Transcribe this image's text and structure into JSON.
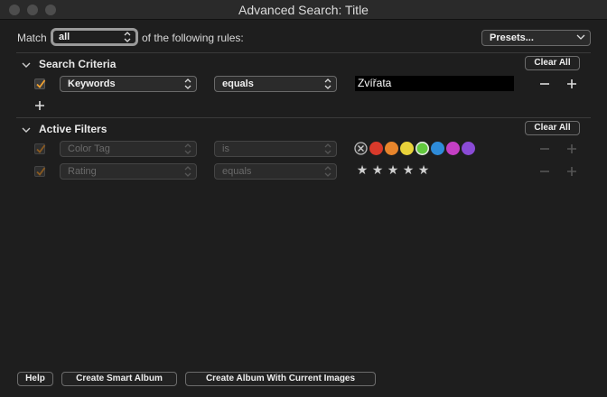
{
  "window": {
    "title": "Advanced Search: Title"
  },
  "match": {
    "prefix": "Match",
    "selected": "all",
    "suffix": "of the following rules:"
  },
  "presets": {
    "label": "Presets..."
  },
  "search_criteria": {
    "title": "Search Criteria",
    "clear_label": "Clear All",
    "rules": [
      {
        "field": "Keywords",
        "operator": "equals",
        "value": "Zvířata"
      }
    ]
  },
  "active_filters": {
    "title": "Active Filters",
    "clear_label": "Clear All",
    "rules": [
      {
        "field": "Color Tag",
        "operator": "is"
      },
      {
        "field": "Rating",
        "operator": "equals"
      }
    ],
    "colors": [
      "#d93a2b",
      "#e8852c",
      "#e8d23a",
      "#62c93e",
      "#2e8bd8",
      "#c43fc4",
      "#8a4bd6"
    ],
    "stars": [
      "★",
      "★",
      "★",
      "★",
      "★"
    ]
  },
  "footer": {
    "help_label": "Help",
    "smart_album_label": "Create Smart Album",
    "album_current_label": "Create Album With Current Images"
  }
}
